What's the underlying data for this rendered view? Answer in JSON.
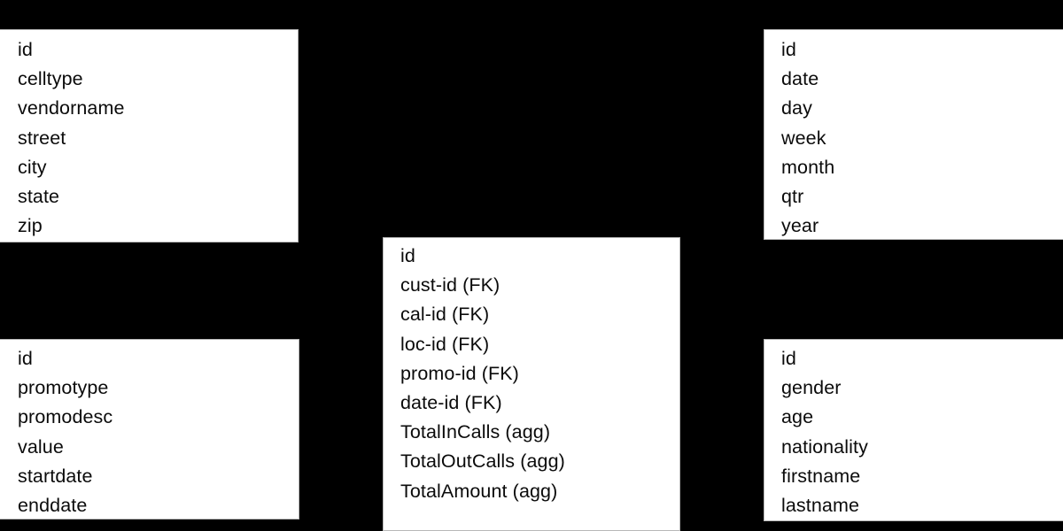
{
  "diagram": {
    "type": "star-schema-er-diagram",
    "background_color": "#000000",
    "entity_fill_color": "#ffffff",
    "entity_text_color": "#0b0b0b",
    "entities": [
      {
        "id": "location",
        "position": "top-left",
        "cropped": "left-edge",
        "fields": [
          "id",
          "celltype",
          "vendorname",
          "street",
          "city",
          "state",
          "zip"
        ]
      },
      {
        "id": "calendar",
        "position": "top-right",
        "cropped": "right-edge",
        "fields": [
          "id",
          "date",
          "day",
          "week",
          "month",
          "qtr",
          "year"
        ]
      },
      {
        "id": "fact",
        "position": "center",
        "cropped": "bottom-edge",
        "fields": [
          "id",
          "cust-id (FK)",
          "cal-id (FK)",
          "loc-id (FK)",
          "promo-id (FK)",
          "date-id (FK)",
          "TotalInCalls (agg)",
          "TotalOutCalls (agg)",
          "TotalAmount (agg)"
        ]
      },
      {
        "id": "promotion",
        "position": "bottom-left",
        "cropped": "left-edge",
        "fields": [
          "id",
          "promotype",
          "promodesc",
          "value",
          "startdate",
          "enddate"
        ]
      },
      {
        "id": "customer",
        "position": "bottom-right",
        "cropped": "right-edge",
        "fields": [
          "id",
          "gender",
          "age",
          "nationality",
          "firstname",
          "lastname"
        ]
      }
    ]
  }
}
